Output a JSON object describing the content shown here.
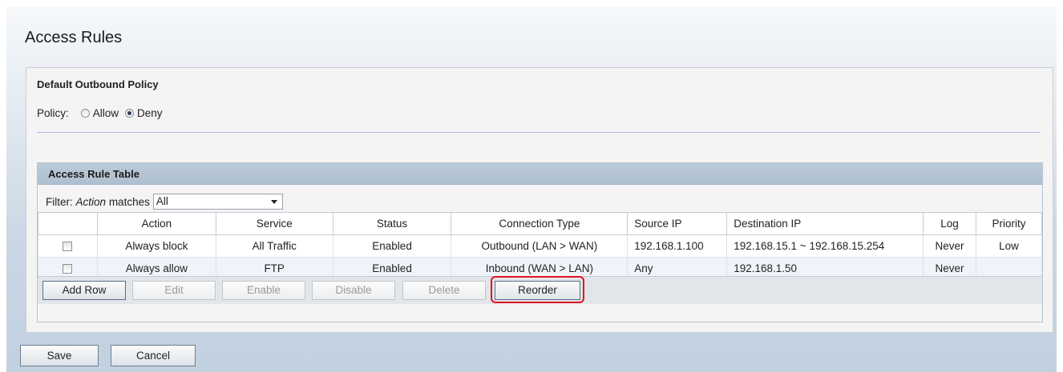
{
  "page": {
    "title": "Access Rules"
  },
  "default_policy": {
    "title": "Default Outbound Policy",
    "label": "Policy:",
    "options": [
      {
        "label": "Allow",
        "checked": false
      },
      {
        "label": "Deny",
        "checked": true
      }
    ]
  },
  "rule_table": {
    "title": "Access Rule Table",
    "filter": {
      "prefix": "Filter:",
      "field": "Action",
      "matches": "matches",
      "value": "All"
    },
    "columns": [
      "",
      "Action",
      "Service",
      "Status",
      "Connection Type",
      "Source IP",
      "Destination IP",
      "Log",
      "Priority"
    ],
    "rows": [
      {
        "checked": false,
        "action": "Always block",
        "service": "All Traffic",
        "status": "Enabled",
        "connection_type": "Outbound (LAN > WAN)",
        "source_ip": "192.168.1.100",
        "destination_ip": "192.168.15.1 ~ 192.168.15.254",
        "log": "Never",
        "priority": "Low"
      },
      {
        "checked": false,
        "action": "Always allow",
        "service": "FTP",
        "status": "Enabled",
        "connection_type": "Inbound (WAN > LAN)",
        "source_ip": "Any",
        "destination_ip": "192.168.1.50",
        "log": "Never",
        "priority": ""
      }
    ],
    "buttons": {
      "add_row": "Add Row",
      "edit": "Edit",
      "enable": "Enable",
      "disable": "Disable",
      "delete": "Delete",
      "reorder": "Reorder"
    }
  },
  "footer": {
    "save": "Save",
    "cancel": "Cancel"
  },
  "colors": {
    "highlight": "#e0161e",
    "header_bg": "#bccbd9"
  }
}
